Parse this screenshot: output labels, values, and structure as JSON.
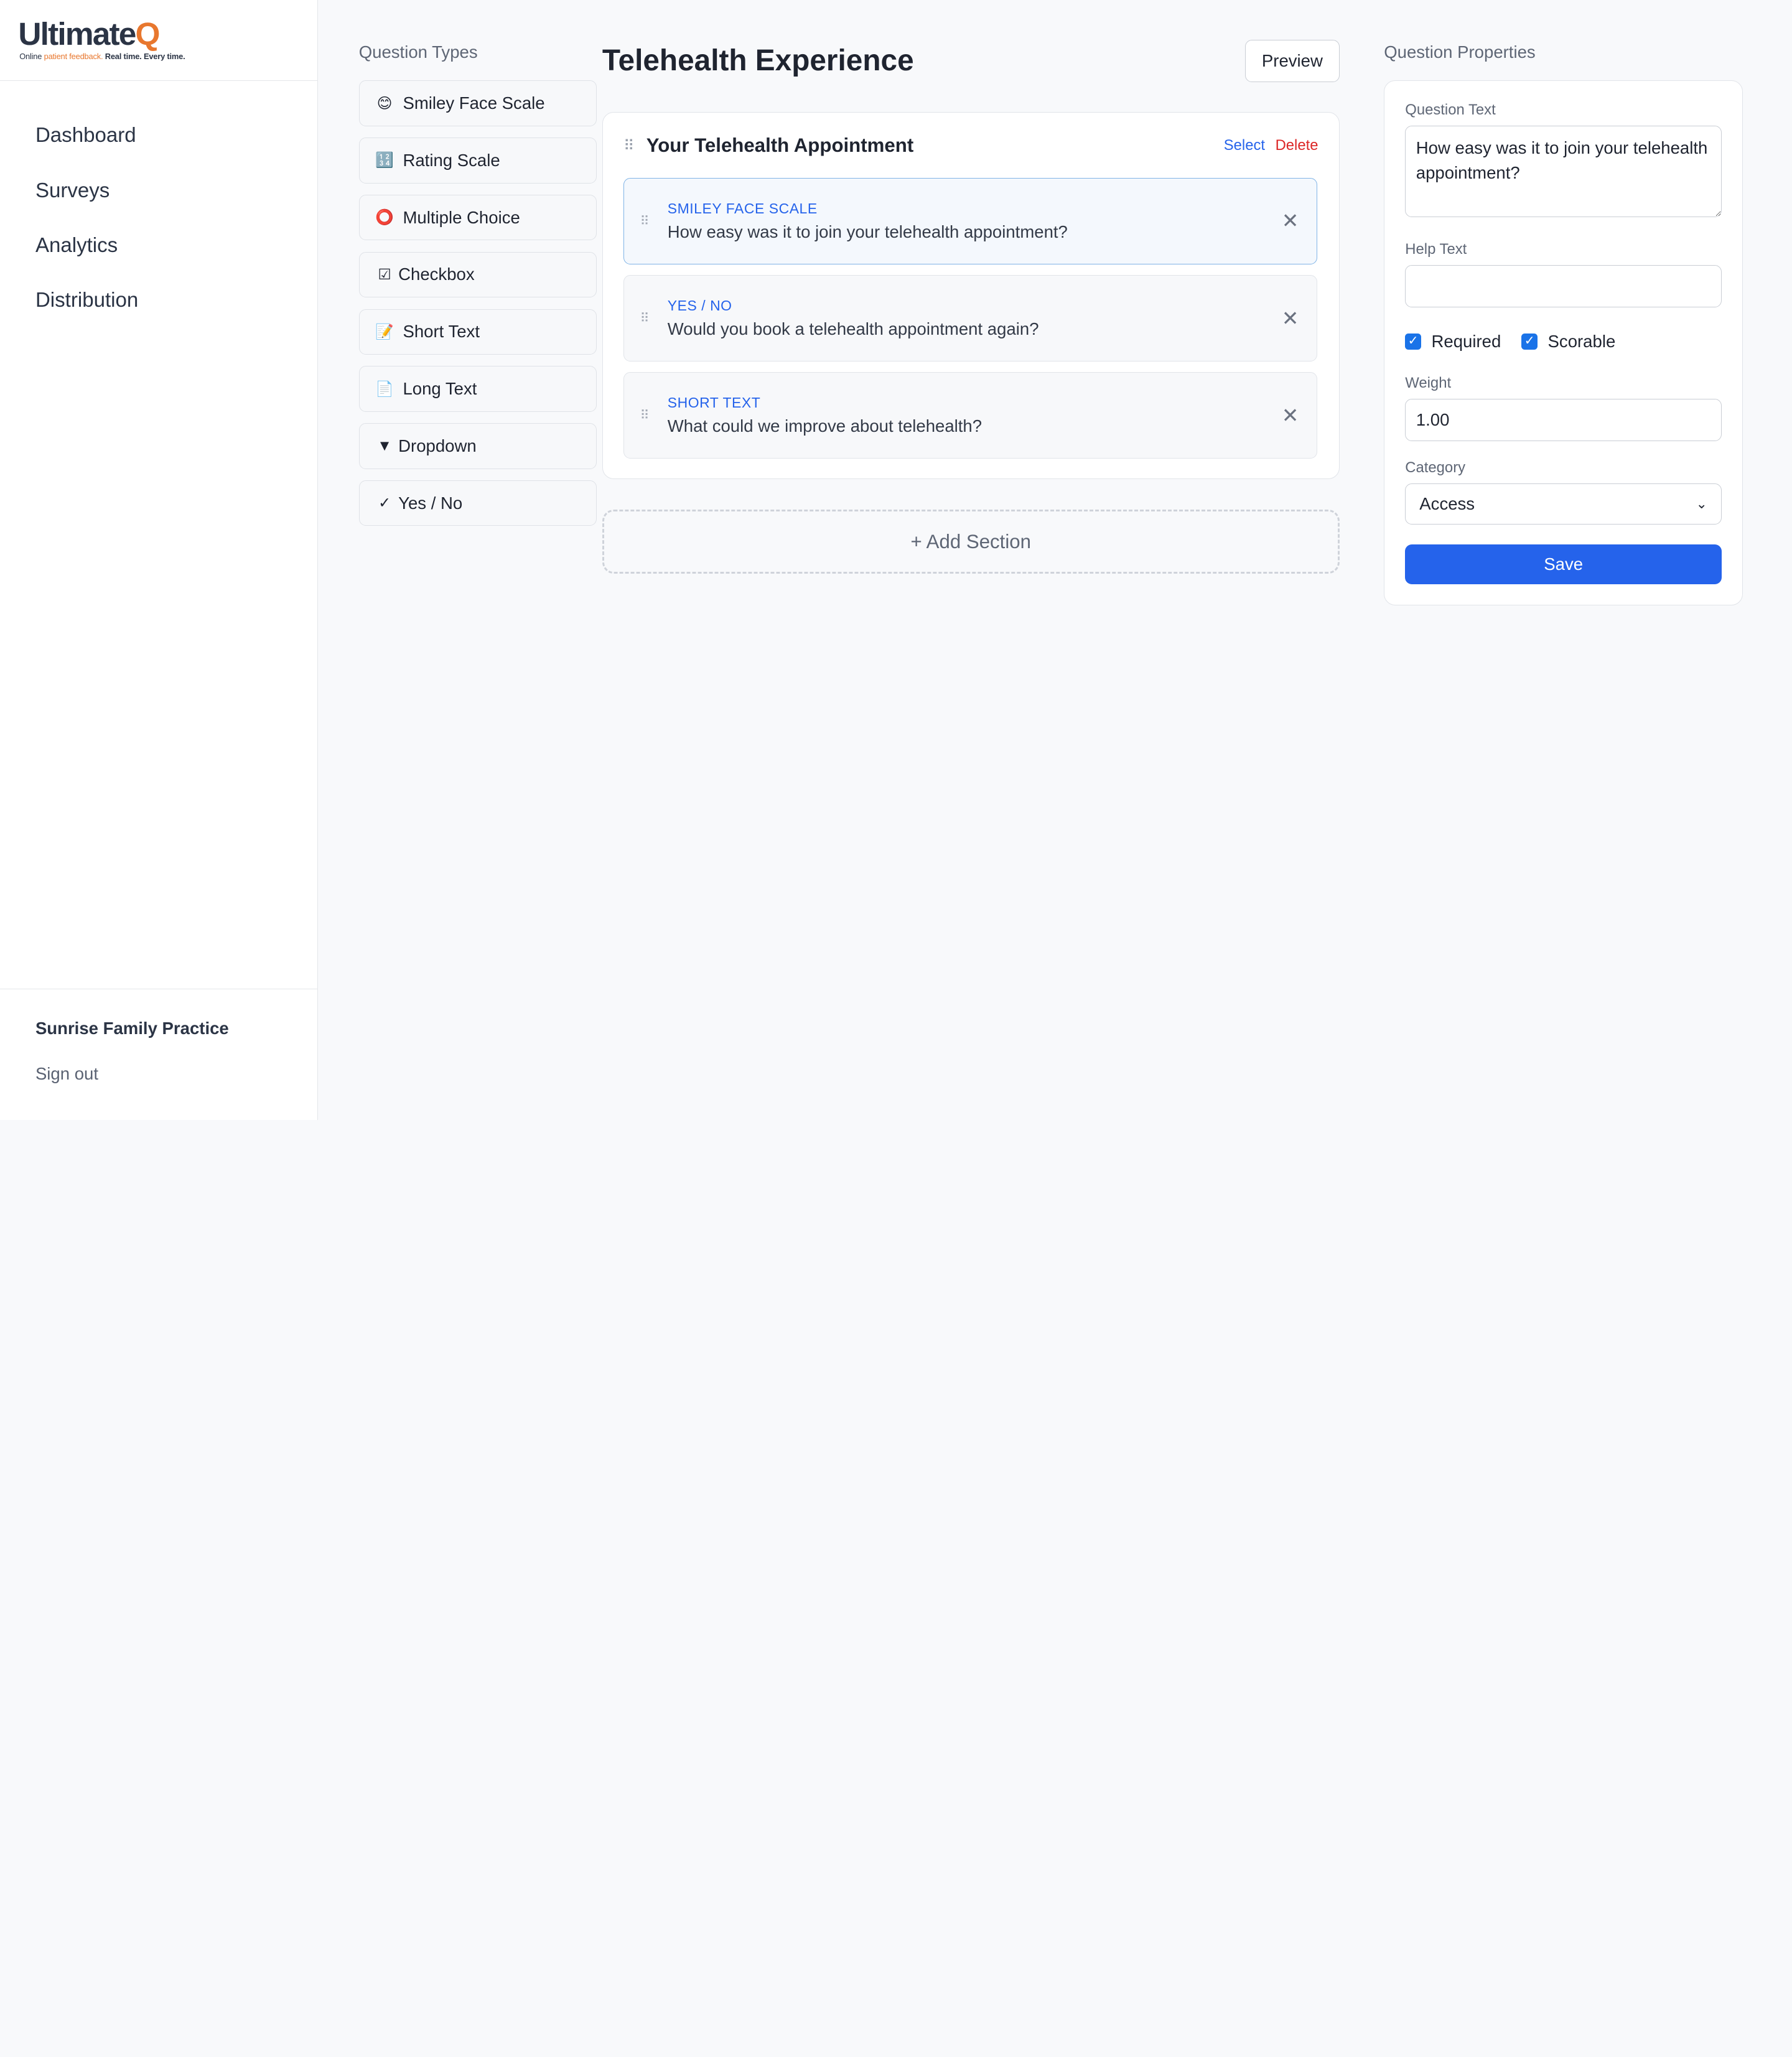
{
  "brand": {
    "name_main": "Ultimate",
    "name_q": "Q",
    "tagline_part1": "Online ",
    "tagline_orange": "patient feedback.",
    "tagline_part2": " Real time. Every time."
  },
  "sidebar": {
    "items": [
      {
        "label": "Dashboard"
      },
      {
        "label": "Surveys"
      },
      {
        "label": "Analytics"
      },
      {
        "label": "Distribution"
      }
    ],
    "practice_name": "Sunrise Family Practice",
    "sign_out": "Sign out"
  },
  "question_types": {
    "title": "Question Types",
    "items": [
      {
        "icon": "😊",
        "label": "Smiley Face Scale"
      },
      {
        "icon": "🔢",
        "label": "Rating Scale"
      },
      {
        "icon": "⭕",
        "label": "Multiple Choice"
      },
      {
        "icon": "☑",
        "label": "Checkbox"
      },
      {
        "icon": "📝",
        "label": "Short Text"
      },
      {
        "icon": "📄",
        "label": "Long Text"
      },
      {
        "icon": "▼",
        "label": "Dropdown"
      },
      {
        "icon": "✓",
        "label": "Yes / No"
      }
    ]
  },
  "builder": {
    "survey_title": "Telehealth Experience",
    "preview_label": "Preview",
    "section": {
      "title": "Your Telehealth Appointment",
      "select_label": "Select",
      "delete_label": "Delete",
      "questions": [
        {
          "type": "SMILEY FACE SCALE",
          "text": "How easy was it to join your telehealth appointment?",
          "selected": true
        },
        {
          "type": "YES / NO",
          "text": "Would you book a telehealth appointment again?",
          "selected": false
        },
        {
          "type": "SHORT TEXT",
          "text": "What could we improve about telehealth?",
          "selected": false
        }
      ]
    },
    "add_section_label": "+ Add Section"
  },
  "properties": {
    "title": "Question Properties",
    "question_text_label": "Question Text",
    "question_text_value": "How easy was it to join your telehealth appointment?",
    "help_text_label": "Help Text",
    "help_text_value": "",
    "required_label": "Required",
    "required_checked": true,
    "scorable_label": "Scorable",
    "scorable_checked": true,
    "weight_label": "Weight",
    "weight_value": "1.00",
    "category_label": "Category",
    "category_value": "Access",
    "save_label": "Save"
  },
  "colors": {
    "accent": "#2563eb",
    "danger": "#dc2626",
    "brand_orange": "#e8772e"
  }
}
